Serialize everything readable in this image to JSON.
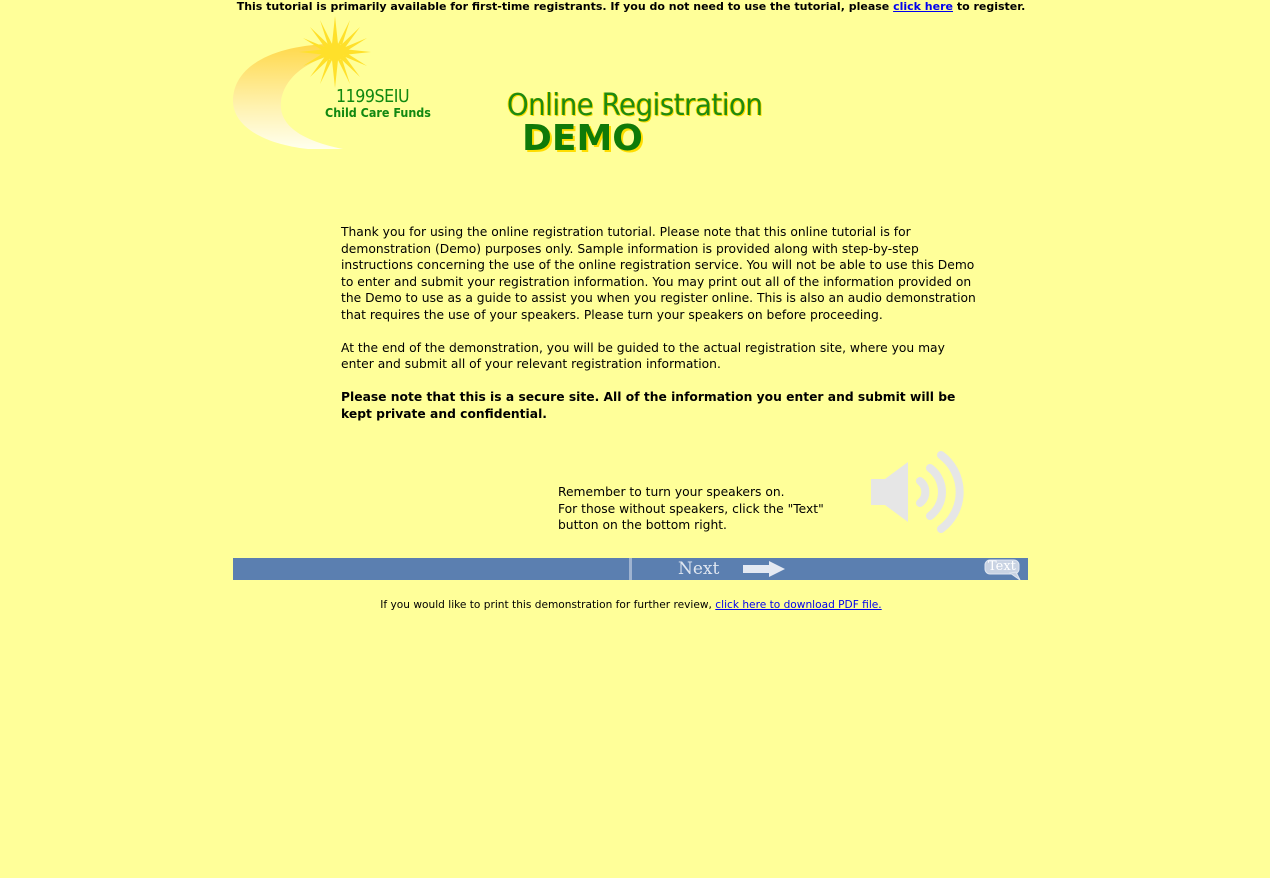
{
  "top_notice": {
    "text_before": "This tutorial is primarily available for first-time registrants. If you do not need to use the tutorial, please ",
    "link_text": "click here",
    "text_after": " to register."
  },
  "logo": {
    "name": "1199SEIU",
    "subtitle": "Child Care Funds",
    "icon": "sun-swoosh-logo"
  },
  "title": {
    "main": "Online Registration",
    "demo": "DEMO"
  },
  "intro": {
    "paragraph1": "Thank you for using the online registration tutorial.  Please note that this online tutorial is for demonstration (Demo) purposes only.  Sample information is provided along with step-by-step instructions concerning the use of the online registration service. You will not be able to use this Demo to enter and submit your registration information.  You may print out all of the information provided on the Demo to use as a guide to assist you when you register online.  This is also an audio demonstration that requires the use of your speakers. Please turn your speakers on before proceeding.",
    "paragraph2": "At the end of the demonstration, you will be guided to the actual registration site, where you may enter and submit all of your relevant registration information.",
    "paragraph3": "Please note that this is a secure site. All of the information you enter and submit will be kept private and confidential."
  },
  "reminder": {
    "line1": "Remember to turn your speakers on.",
    "line2": "For those without speakers, click the \"Text\"",
    "line3": "button on the bottom right.",
    "icon": "speaker-icon"
  },
  "navbar": {
    "next_label": "Next",
    "text_label": "Text",
    "colors": {
      "bar": "#5b7fb0"
    }
  },
  "print_line": {
    "text_before": "If you would like to print this demonstration for further review, ",
    "link_text": "click here to download PDF file."
  },
  "colors": {
    "background": "#ffff99",
    "title_green": "#1e8a12"
  }
}
